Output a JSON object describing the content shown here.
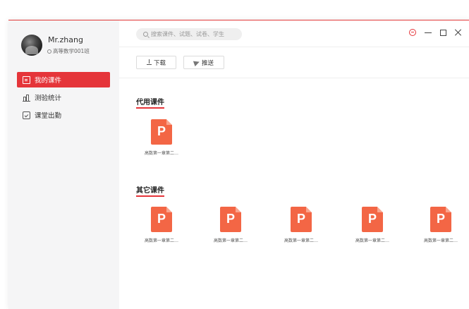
{
  "user": {
    "name": "Mr.zhang",
    "class": "高等数学001班"
  },
  "nav": {
    "items": [
      {
        "label": "我的课件",
        "icon": "courseware-icon",
        "active": true
      },
      {
        "label": "测验统计",
        "icon": "bar-chart-icon",
        "active": false
      },
      {
        "label": "课堂出勤",
        "icon": "attendance-calendar-icon",
        "active": false
      }
    ]
  },
  "search": {
    "placeholder": "搜索课件、试题、试卷、学生"
  },
  "toolbar": {
    "download_label": "下载",
    "push_label": "推送"
  },
  "sections": {
    "used": {
      "title": "代用课件",
      "files": [
        {
          "name": "高数第一章第二…",
          "type": "ppt"
        }
      ]
    },
    "other": {
      "title": "其它课件",
      "files": [
        {
          "name": "高数第一章第二…",
          "type": "ppt"
        },
        {
          "name": "高数第一章第二…",
          "type": "ppt"
        },
        {
          "name": "高数第一章第二…",
          "type": "ppt"
        },
        {
          "name": "高数第一章第二…",
          "type": "ppt"
        },
        {
          "name": "高数第一章第二…",
          "type": "ppt"
        }
      ]
    }
  },
  "file_icon_letter": "P",
  "colors": {
    "accent": "#e5353a",
    "ppt": "#f36645"
  }
}
